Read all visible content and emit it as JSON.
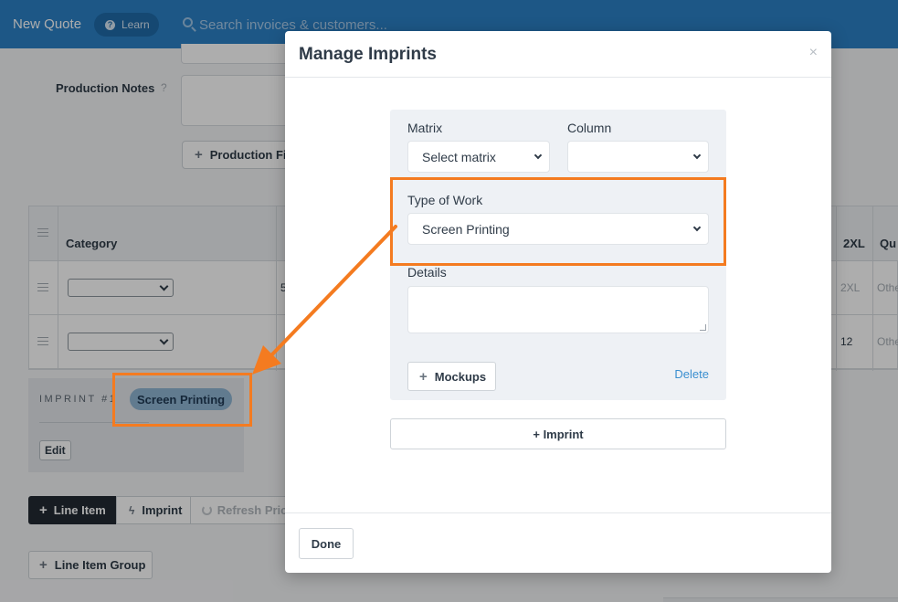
{
  "colors": {
    "topbar": "#2b80c6",
    "accent_orange": "#f47b20",
    "link_blue": "#3a8fd0",
    "chip_blue": "#8fb5d3"
  },
  "topbar": {
    "title": "New Quote",
    "learn_label": "Learn",
    "learn_icon": "question-circle-icon",
    "search_placeholder": "Search invoices & customers..."
  },
  "background": {
    "production_notes_label": "Production Notes",
    "production_notes_help": "?",
    "production_files_button": "Production Fil",
    "table": {
      "headers": {
        "category": "Category",
        "size_2xl": "2XL",
        "qu": "Qu"
      },
      "rows": [
        {
          "frag": "5",
          "size_2xl": "2XL",
          "qu": "Othe"
        },
        {
          "frag": "",
          "size_2xl": "12",
          "qu": "Othe"
        }
      ]
    },
    "imprint": {
      "label": "IMPRINT #1",
      "chip": "Screen Printing",
      "edit_button": "Edit"
    },
    "buttons": {
      "line_item": "Line Item",
      "imprint": "Imprint",
      "refresh_pricing": "Refresh Prici",
      "line_item_group": "Line Item Group"
    }
  },
  "modal": {
    "title": "Manage Imprints",
    "close_symbol": "×",
    "form": {
      "matrix_label": "Matrix",
      "matrix_value": "Select matrix",
      "column_label": "Column",
      "column_value": "",
      "type_of_work_label": "Type of Work",
      "type_of_work_value": "Screen Printing",
      "details_label": "Details",
      "details_value": "",
      "mockups_button": "Mockups",
      "delete_link": "Delete"
    },
    "add_imprint_button": "+ Imprint",
    "done_button": "Done"
  }
}
